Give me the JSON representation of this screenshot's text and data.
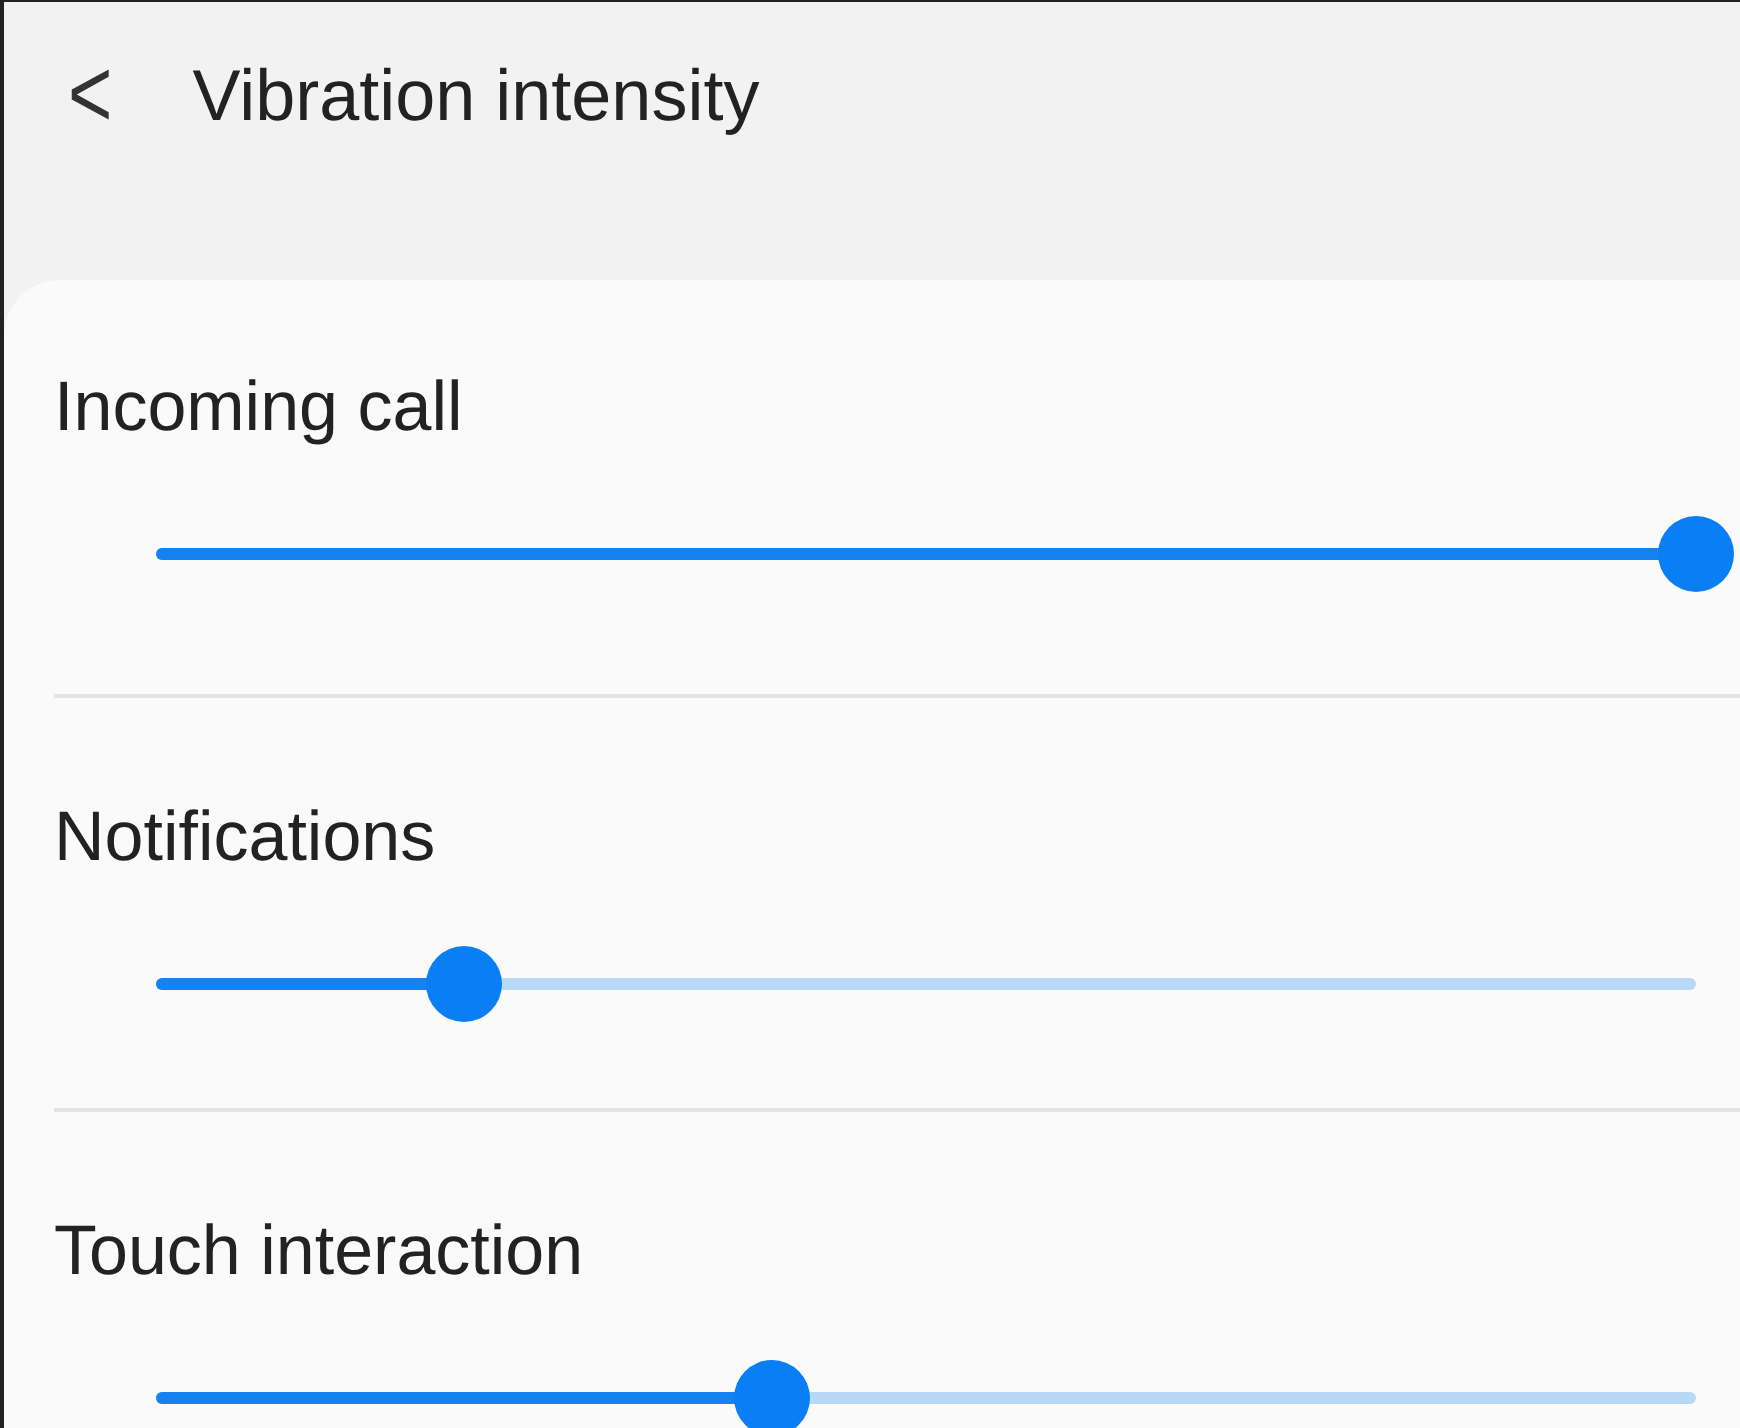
{
  "header": {
    "back": "<",
    "title": "Vibration intensity"
  },
  "settings": [
    {
      "label": "Incoming call",
      "level": 1.0
    },
    {
      "label": "Notifications",
      "level": 0.2
    },
    {
      "label": "Touch interaction",
      "level": 0.4
    }
  ]
}
